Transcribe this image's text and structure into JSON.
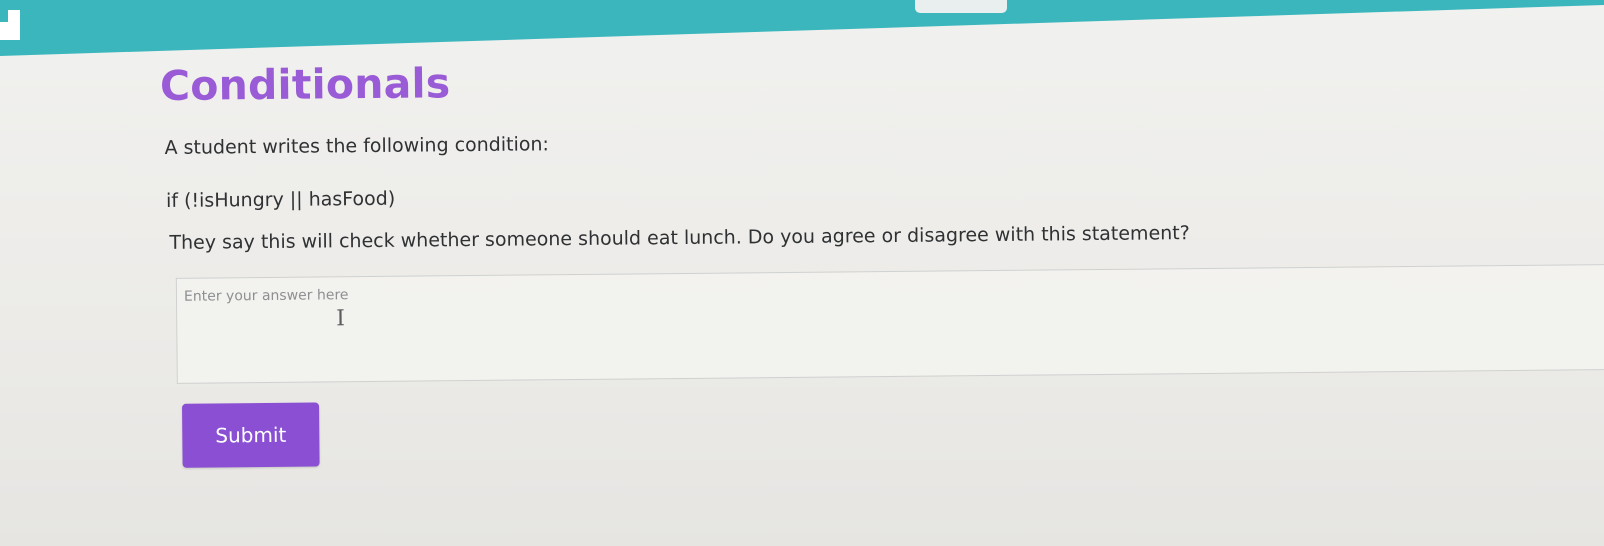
{
  "header": {
    "accent_color": "#3bb6bd"
  },
  "lesson": {
    "title": "Conditionals",
    "title_color": "#9a5bd6",
    "prompt": "A student writes the following condition:",
    "code": "if (!isHungry || hasFood)",
    "question": "They say this will check whether someone should eat lunch. Do you agree or disagree with this statement?"
  },
  "answer": {
    "placeholder": "Enter your answer here",
    "value": ""
  },
  "actions": {
    "submit_label": "Submit",
    "submit_color": "#8a4fd2"
  },
  "icons": {
    "text_cursor": "text-cursor-icon",
    "logo": "logo-icon"
  }
}
